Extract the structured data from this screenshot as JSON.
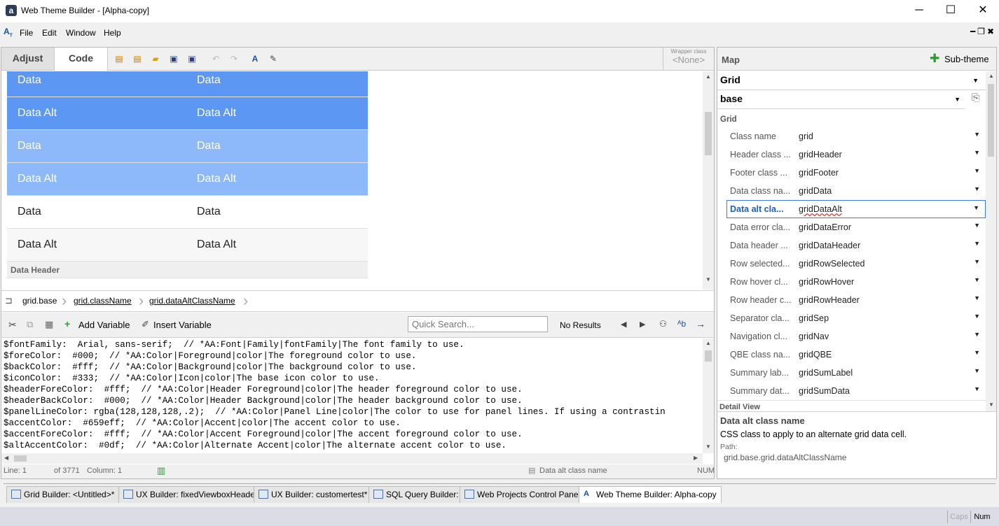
{
  "window": {
    "title": "Web Theme Builder - [Alpha-copy]",
    "app_icon": "a",
    "min": "─",
    "max": "☐",
    "close": "✕"
  },
  "menu": [
    "File",
    "Edit",
    "Window",
    "Help"
  ],
  "tabs": {
    "adjust": "Adjust",
    "code": "Code"
  },
  "wrapper": {
    "label": "Wrapper class",
    "value": "<None>"
  },
  "preview_rows": [
    {
      "c1": "Data",
      "c2": "Data",
      "style": "r-sel"
    },
    {
      "c1": "Data Alt",
      "c2": "Data Alt",
      "style": "r-sel"
    },
    {
      "c1": "Data",
      "c2": "Data",
      "style": "r-hov"
    },
    {
      "c1": "Data Alt",
      "c2": "Data Alt",
      "style": "r-hov"
    },
    {
      "c1": "Data",
      "c2": "Data",
      "style": "r-plain"
    },
    {
      "c1": "Data Alt",
      "c2": "Data Alt",
      "style": "r-alt"
    }
  ],
  "preview_header": "Data Header",
  "breadcrumb": [
    "grid.base",
    "grid.className",
    "grid.dataAltClassName"
  ],
  "code_toolbar": {
    "add_variable": "Add Variable",
    "insert_variable": "Insert Variable",
    "search_placeholder": "Quick Search...",
    "results": "No Results"
  },
  "code_lines": [
    "$fontFamily:  Arial, sans-serif;  // *AA:Font|Family|fontFamily|The font family to use.",
    "$foreColor:  #000;  // *AA:Color|Foreground|color|The foreground color to use.",
    "$backColor:  #fff;  // *AA:Color|Background|color|The background color to use.",
    "$iconColor:  #333;  // *AA:Color|Icon|color|The base icon color to use.",
    "$headerForeColor:  #fff;  // *AA:Color|Header Foreground|color|The header foreground color to use.",
    "$headerBackColor:  #000;  // *AA:Color|Header Background|color|The header background color to use.",
    "$panelLineColor: rgba(128,128,128,.2);  // *AA:Color|Panel Line|color|The color to use for panel lines. If using a contrastin",
    "$accentColor:  #659eff;  // *AA:Color|Accent|color|The accent color to use.",
    "$accentForeColor:  #fff;  // *AA:Color|Accent Foreground|color|The accent foreground color to use.",
    "$altAccentColor:  #0df;  // *AA:Color|Alternate Accent|color|The alternate accent color to use."
  ],
  "status": {
    "line": "Line: 1",
    "of": "of 3771",
    "column": "Column: 1",
    "property": "Data alt class name",
    "num": "NUM"
  },
  "map": {
    "title": "Map",
    "sub_theme": "Sub-theme",
    "combo1": "Grid",
    "combo2": "base",
    "section": "Grid",
    "section2": "Detail View",
    "props": [
      {
        "name": "Class name",
        "value": "grid"
      },
      {
        "name": "Header class ...",
        "value": "gridHeader"
      },
      {
        "name": "Footer class ...",
        "value": "gridFooter"
      },
      {
        "name": "Data class na...",
        "value": "gridData"
      },
      {
        "name": "Data alt cla...",
        "value": "gridDataAlt"
      },
      {
        "name": "Data error cla...",
        "value": "gridDataError"
      },
      {
        "name": "Data header ...",
        "value": "gridDataHeader"
      },
      {
        "name": "Row selected...",
        "value": "gridRowSelected"
      },
      {
        "name": "Row hover cl...",
        "value": "gridRowHover"
      },
      {
        "name": "Row header c...",
        "value": "gridRowHeader"
      },
      {
        "name": "Separator cla...",
        "value": "gridSep"
      },
      {
        "name": "Navigation cl...",
        "value": "gridNav"
      },
      {
        "name": "QBE class na...",
        "value": "gridQBE"
      },
      {
        "name": "Summary lab...",
        "value": "gridSumLabel"
      },
      {
        "name": "Summary dat...",
        "value": "gridSumData"
      }
    ],
    "selected_index": 4
  },
  "detail": {
    "title": "Data alt class name",
    "description": "CSS class to apply to an alternate grid data cell.",
    "path_label": "Path:",
    "path": "grid.base.grid.dataAltClassName"
  },
  "task_tabs": [
    {
      "label": "Grid Builder: <Untitled>*"
    },
    {
      "label": "UX Builder: fixedViewboxHeader"
    },
    {
      "label": "UX Builder: customertest*"
    },
    {
      "label": "SQL Query Builder:"
    },
    {
      "label": "Web Projects Control Panel"
    },
    {
      "label": "Web Theme Builder: Alpha-copy"
    }
  ],
  "bottom_status": {
    "caps": "Caps",
    "num": "Num"
  },
  "colors": {
    "selected_row": "#5c97f3",
    "hover_row": "#8db8f9",
    "selection_border": "#3a7bd5"
  }
}
